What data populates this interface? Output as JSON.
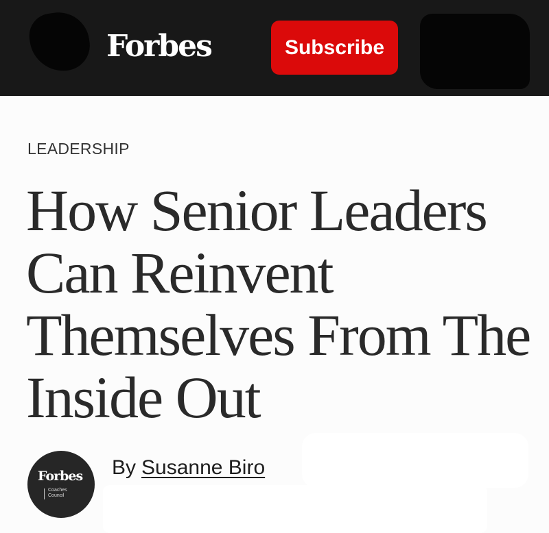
{
  "header": {
    "logo": "Forbes",
    "subscribe_label": "Subscribe"
  },
  "article": {
    "section": "LEADERSHIP",
    "headline": "How Senior Leaders Can Reinvent Themselves From The Inside Out",
    "byline_prefix": "By",
    "author": "Susanne Biro",
    "avatar": {
      "logo": "Forbes",
      "subtitle_line1": "Coaches",
      "subtitle_line2": "Council"
    }
  },
  "colors": {
    "header_bg": "#181818",
    "subscribe_bg": "#db0a0a",
    "text": "#2a2a2a"
  }
}
